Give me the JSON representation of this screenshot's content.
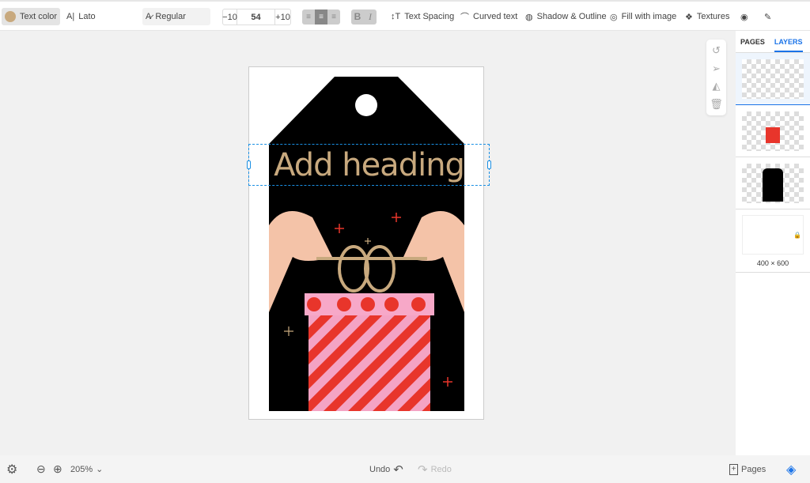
{
  "toolbar": {
    "text_color_label": "Text color",
    "text_color": "#c8a97e",
    "font": "Lato",
    "weight": "Regular",
    "size_minus": "−10",
    "size_value": "54",
    "size_plus": "+10",
    "bold": "B",
    "italic": "I",
    "text_spacing": "Text Spacing",
    "curved_text": "Curved text",
    "shadow_outline": "Shadow & Outline",
    "fill_image": "Fill with image",
    "textures": "Textures"
  },
  "canvas": {
    "heading": "Add heading"
  },
  "panel": {
    "tab_pages": "PAGES",
    "tab_layers": "LAYERS",
    "page_size": "400 × 600"
  },
  "bottom": {
    "zoom": "205%",
    "undo": "Undo",
    "redo": "Redo",
    "pages": "Pages"
  }
}
